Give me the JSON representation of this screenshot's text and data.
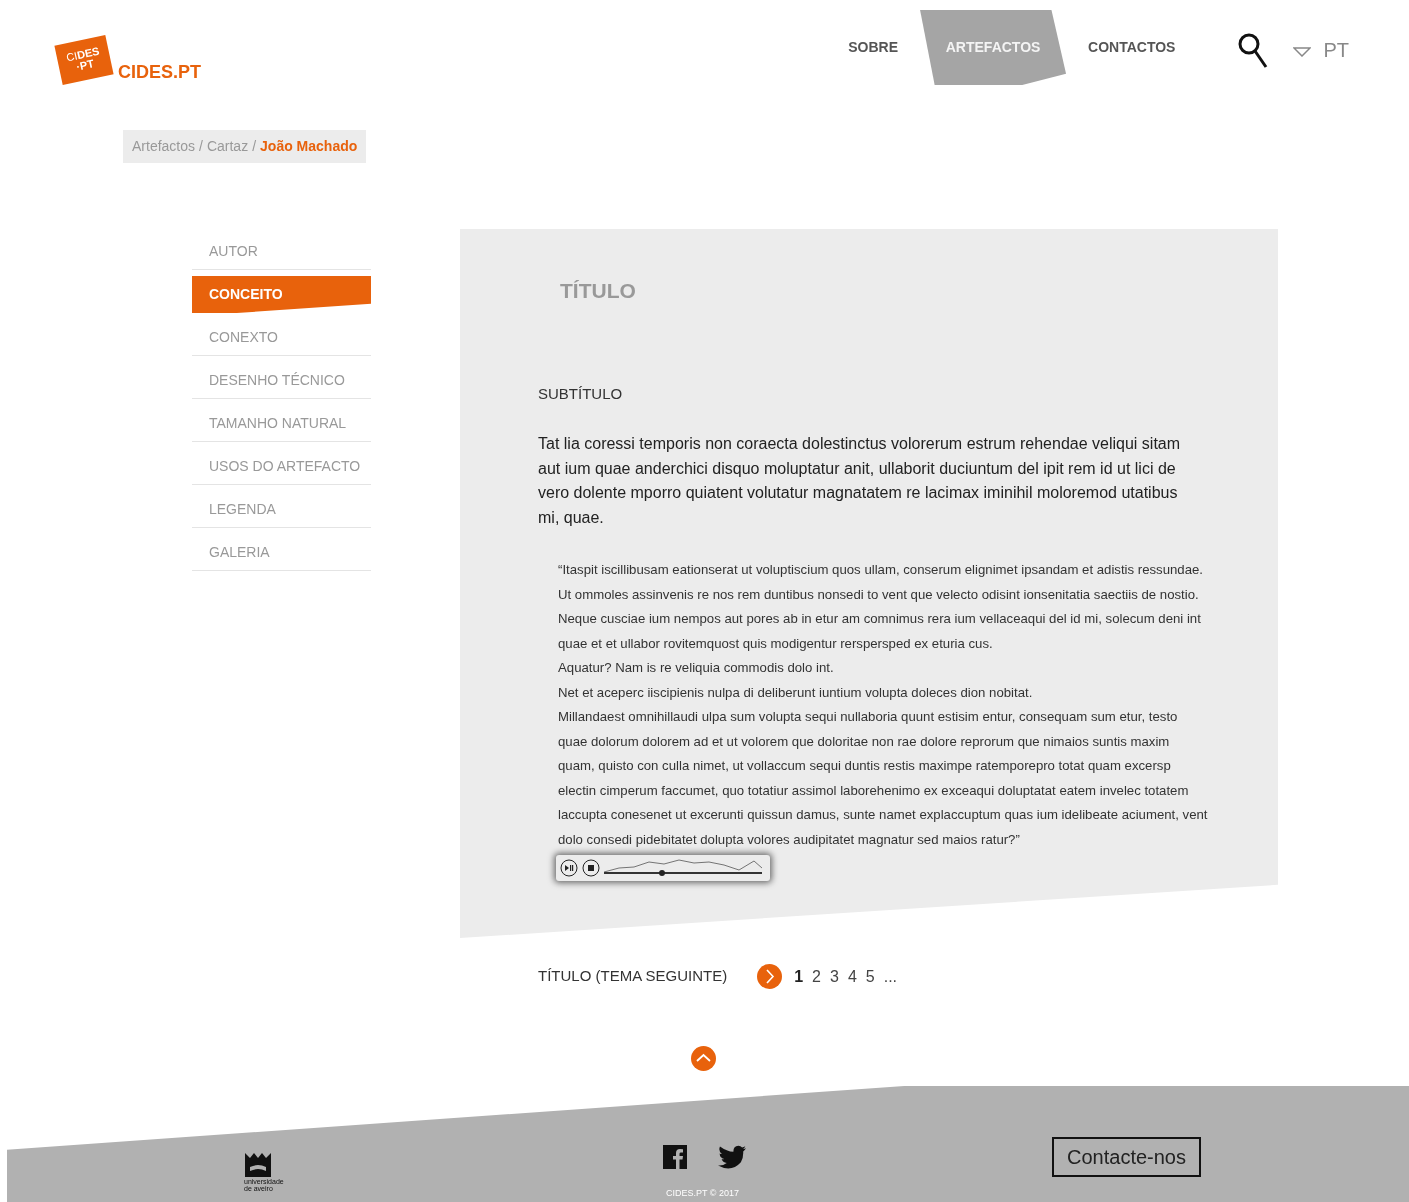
{
  "logo": {
    "mark": [
      "CI**DES**",
      "·PT"
    ],
    "name": "CIDES.PT"
  },
  "nav": [
    {
      "label": "SOBRE",
      "selected": false
    },
    {
      "label": "ARTEFACTOS",
      "selected": true
    },
    {
      "label": "CONTACTOS",
      "selected": false
    }
  ],
  "language": "PT",
  "breadcrumb_separators": [
    "/",
    "/"
  ],
  "breadcrumb": [
    {
      "label": "Artefactos",
      "current": false
    },
    {
      "label": "Cartaz",
      "current": false
    },
    {
      "label": "João Machado",
      "current": true
    }
  ],
  "sidebar": {
    "items": [
      {
        "label": "AUTOR",
        "selected": false
      },
      {
        "label": "CONCEITO",
        "selected": true
      },
      {
        "label": "CONEXTO",
        "selected": false
      },
      {
        "label": "DESENHO TÉCNICO",
        "selected": false
      },
      {
        "label": "TAMANHO NATURAL",
        "selected": false
      },
      {
        "label": "USOS DO ARTEFACTO",
        "selected": false
      },
      {
        "label": "LEGENDA",
        "selected": false
      },
      {
        "label": "GALERIA",
        "selected": false
      }
    ]
  },
  "article": {
    "title": "TÍTULO",
    "subtitle": "SUBTÍTULO",
    "intro": "Tat lia coressi temporis non coraecta dolestinctus volorerum estrum rehendae veliqui sitam aut ium quae anderchici disquo moluptatur anit, ullaborit duciuntum del ipit rem id ut lici de vero dolente mporro quiatent volutatur magnatatem re lacimax iminihil moloremod utatibus mi, quae.",
    "quote": [
      "“Itaspit iscillibusam eationserat ut voluptiscium quos ullam, conserum elignimet ipsandam et adistis ressundae. Ut ommoles assinvenis re nos rem duntibus nonsedi to vent que velecto odisint ionsenitatia saectiis de nostio. Neque cusciae ium nempos aut pores ab in etur am comnimus rera ium vellaceaqui del id mi, solecum deni int quae et et ullabor rovitemquost quis modigentur rerspersped ex eturia cus.",
      "Aquatur? Nam is re veliquia commodis dolo int.",
      "Net et aceperc iiscipienis nulpa di deliberunt iuntium volupta doleces dion nobitat.",
      "Millandaest omnihillaudi ulpa sum volupta sequi nullaboria quunt estisim entur, consequam sum etur, testo quae dolorum dolorem ad et ut volorem que doloritae non rae dolore reprorum que nimaios suntis maxim quam, quisto con culla nimet, ut vollaccum sequi duntis restis maximpe ratemporepro totat quam excersp electin cimperum faccumet, quo totatiur assimol laborehenimo ex exceaqui doluptatat eatem invelec totatem laccupta conesenet ut excerunti quissun damus, sunte namet explaccuptum quas ium idelibeate aciument, vent dolo consedi pidebitatet dolupta volores audipitatet magnatur sed maios ratur?”"
    ],
    "audio_player": {
      "level": 0.37
    }
  },
  "next": {
    "label": "TÍTULO (TEMA SEGUINTE)",
    "pages": [
      {
        "label": "1",
        "selected": true
      },
      {
        "label": "2",
        "selected": false
      },
      {
        "label": "3",
        "selected": false
      },
      {
        "label": "4",
        "selected": false
      },
      {
        "label": "5",
        "selected": false
      }
    ],
    "more": "..."
  },
  "footer": {
    "university": [
      "universidade",
      "de aveiro"
    ],
    "copyright": "CIDES.PT © 2017",
    "contact_button": "Contacte-nos"
  }
}
